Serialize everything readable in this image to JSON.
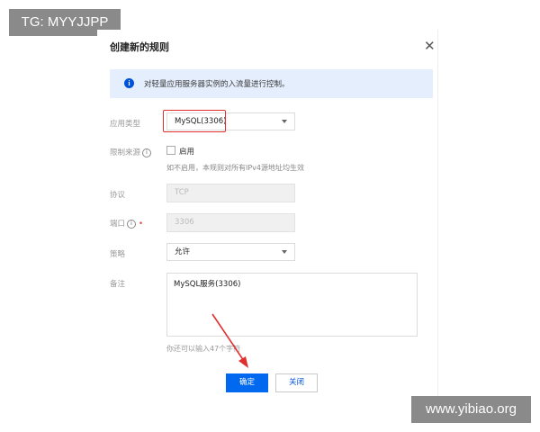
{
  "watermarks": {
    "top_left": "TG: MYYJJPP",
    "bottom_right": "www.yibiao.org"
  },
  "dialog": {
    "title": "创建新的规则",
    "info": "对轻量应用服务器实例的入流量进行控制。",
    "fields": {
      "app_type": {
        "label": "应用类型",
        "value": "MySQL(3306)"
      },
      "source_limit": {
        "label": "限制来源",
        "checkbox_label": "启用",
        "checked": false,
        "hint": "如不启用，本规则对所有IPv4源地址均生效"
      },
      "protocol": {
        "label": "协议",
        "value": "TCP"
      },
      "port": {
        "label": "端口",
        "value": "3306"
      },
      "policy": {
        "label": "策略",
        "value": "允许"
      },
      "remark": {
        "label": "备注",
        "value": "MySQL服务(3306)",
        "remaining": "你还可以输入47个字符"
      }
    },
    "buttons": {
      "confirm": "确定",
      "close": "关闭"
    }
  },
  "colors": {
    "primary": "#0069f0",
    "info_bg": "#e5eefd",
    "highlight": "#e0302e",
    "required": "#e54545"
  },
  "icons": [
    "close-icon",
    "info-icon",
    "question-icon",
    "caret-down-icon",
    "annotation-arrow"
  ]
}
